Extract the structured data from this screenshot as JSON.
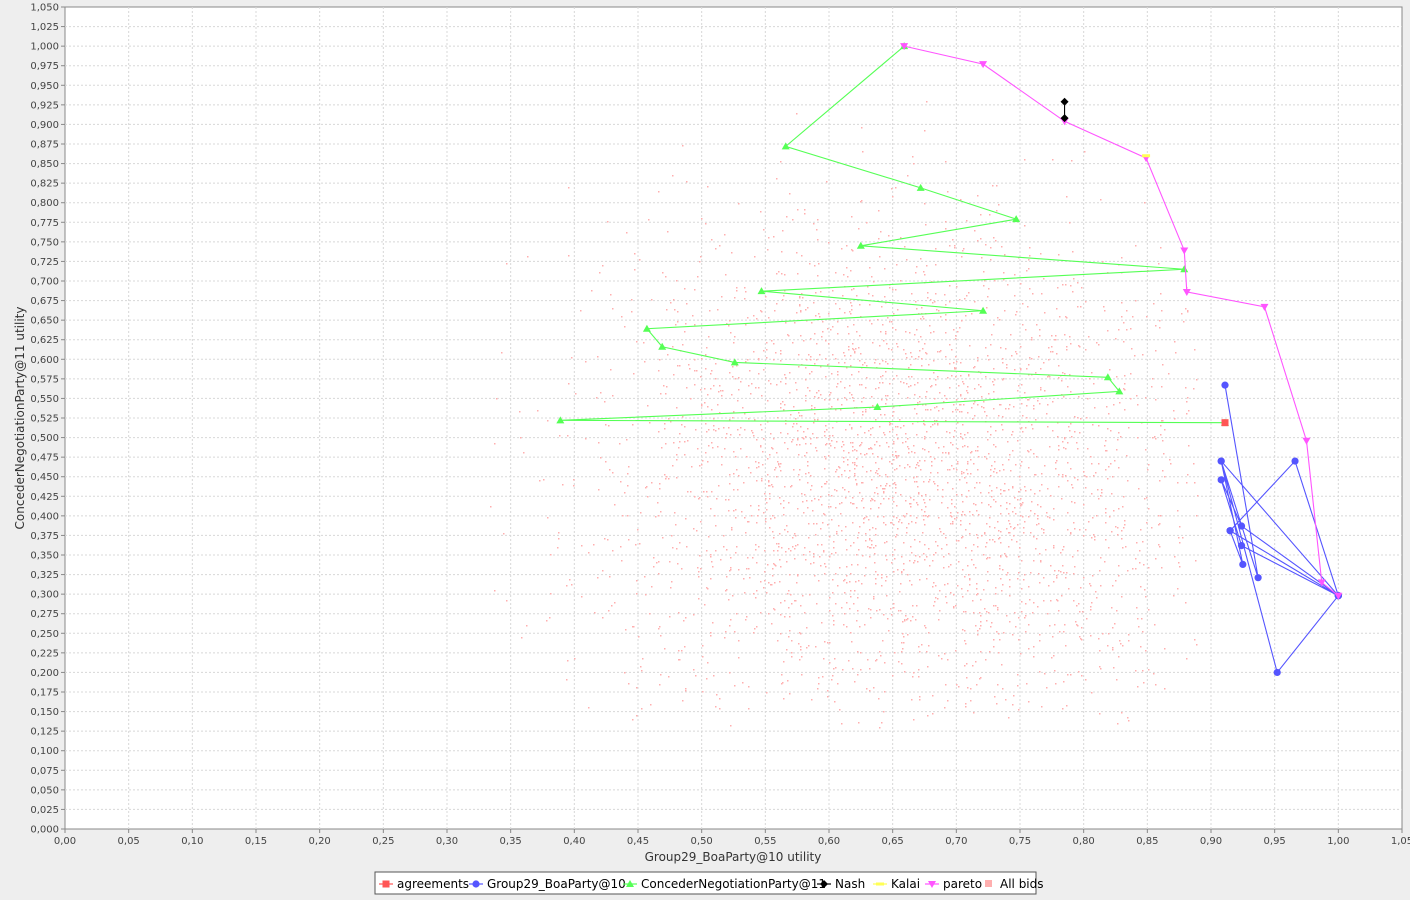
{
  "chart_data": {
    "type": "scatter",
    "title": "",
    "xlabel": "Group29_BoaParty@10 utility",
    "ylabel": "ConcederNegotiationParty@11 utility",
    "xlim": [
      0,
      1.05
    ],
    "ylim": [
      0,
      1.05
    ],
    "x_tick_step": 0.05,
    "y_tick_step": 0.025,
    "decimal_separator": ",",
    "grid": true,
    "legend_position": "bottom-center",
    "legend": [
      "agreements",
      "Group29_BoaParty@10",
      "ConcederNegotiationParty@11",
      "Nash",
      "Kalai",
      "pareto",
      "All bids"
    ],
    "colors": {
      "agreements": "#ff5555",
      "Group29_BoaParty@10": "#5555ff",
      "ConcederNegotiationParty@11": "#55ff55",
      "Nash": "#000000",
      "Kalai": "#ffff55",
      "pareto": "#ff55ff",
      "All bids": "#ffafaf"
    },
    "series": [
      {
        "name": "agreements",
        "marker": "square",
        "connected": false,
        "points": [
          [
            0.911,
            0.519
          ]
        ]
      },
      {
        "name": "Group29_BoaParty@10",
        "marker": "circle",
        "connected": true,
        "points": [
          [
            0.911,
            0.567
          ],
          [
            0.937,
            0.321
          ],
          [
            0.908,
            0.47
          ],
          [
            1.0,
            0.298
          ],
          [
            0.966,
            0.47
          ],
          [
            0.915,
            0.381
          ],
          [
            1.0,
            0.298
          ],
          [
            0.924,
            0.387
          ],
          [
            0.908,
            0.446
          ],
          [
            0.924,
            0.362
          ],
          [
            1.0,
            0.298
          ],
          [
            0.915,
            0.381
          ],
          [
            0.925,
            0.338
          ],
          [
            0.908,
            0.47
          ],
          [
            0.952,
            0.2
          ],
          [
            1.0,
            0.298
          ]
        ]
      },
      {
        "name": "ConcederNegotiationParty@11",
        "marker": "triangle-up",
        "connected": true,
        "points": [
          [
            0.659,
            1.0
          ],
          [
            0.566,
            0.872
          ],
          [
            0.672,
            0.819
          ],
          [
            0.747,
            0.779
          ],
          [
            0.625,
            0.745
          ],
          [
            0.879,
            0.715
          ],
          [
            0.547,
            0.687
          ],
          [
            0.721,
            0.662
          ],
          [
            0.457,
            0.639
          ],
          [
            0.469,
            0.616
          ],
          [
            0.526,
            0.596
          ],
          [
            0.819,
            0.577
          ],
          [
            0.828,
            0.559
          ],
          [
            0.638,
            0.539
          ],
          [
            0.389,
            0.522
          ],
          [
            0.911,
            0.519
          ]
        ]
      },
      {
        "name": "Nash",
        "marker": "diamond",
        "connected": true,
        "points": [
          [
            0.785,
            0.929
          ],
          [
            0.785,
            0.908
          ]
        ]
      },
      {
        "name": "Kalai",
        "marker": "bar",
        "connected": false,
        "points": [
          [
            0.849,
            0.86
          ]
        ]
      },
      {
        "name": "pareto",
        "marker": "triangle-down",
        "connected": true,
        "points": [
          [
            0.659,
            1.0
          ],
          [
            0.721,
            0.977
          ],
          [
            0.785,
            0.904
          ],
          [
            0.849,
            0.857
          ],
          [
            0.879,
            0.739
          ],
          [
            0.881,
            0.686
          ],
          [
            0.942,
            0.667
          ],
          [
            0.975,
            0.496
          ],
          [
            0.987,
            0.315
          ],
          [
            1.0,
            0.298
          ]
        ]
      },
      {
        "name": "All bids",
        "marker": "dot",
        "connected": false,
        "count": 2900,
        "cluster_center": [
          0.66,
          0.46
        ],
        "cluster_spread": [
          0.12,
          0.16
        ],
        "x_range": [
          0.31,
          0.89
        ],
        "y_range": [
          0.13,
          0.97
        ]
      }
    ]
  }
}
